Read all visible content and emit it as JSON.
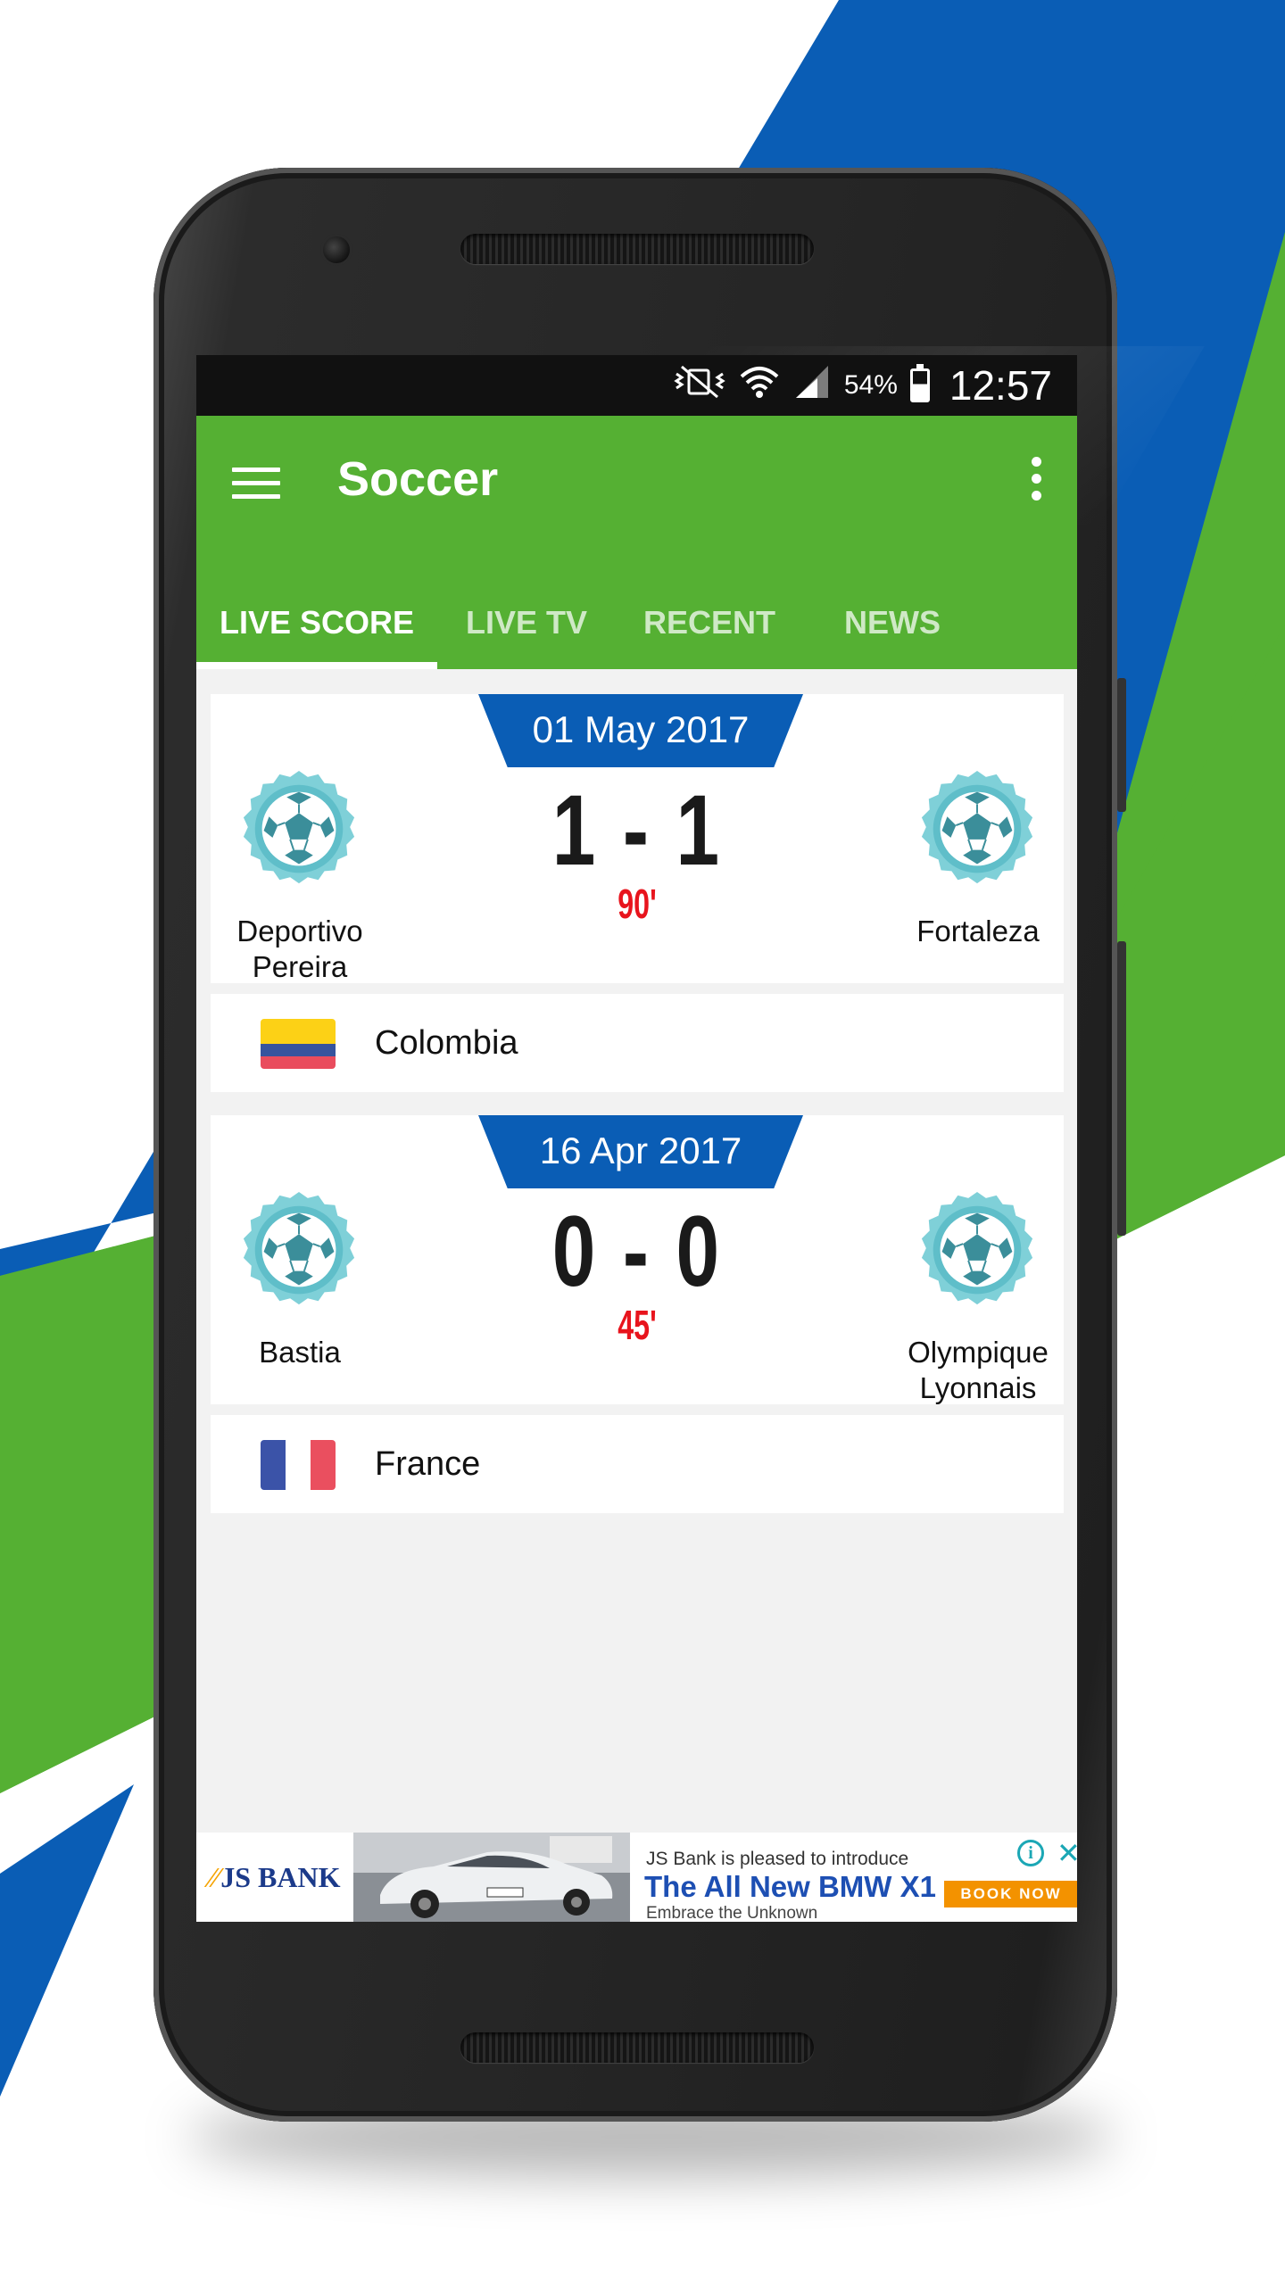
{
  "colors": {
    "background_blue": "#0a5db5",
    "background_green": "#55b033",
    "app_bar_green": "#55b033",
    "date_banner_blue": "#0a5db5",
    "minute_red": "#e8141d"
  },
  "status_bar": {
    "icons": [
      "vibrate-mute-icon",
      "wifi-icon",
      "signal-icon",
      "battery-icon"
    ],
    "battery": "54%",
    "time": "12:57"
  },
  "app_bar": {
    "menu_icon": "hamburger-menu-icon",
    "title": "Soccer",
    "overflow_icon": "more-vertical-icon"
  },
  "tabs": [
    {
      "label": "LIVE SCORE",
      "active": true
    },
    {
      "label": "LIVE TV",
      "active": false
    },
    {
      "label": "RECENT",
      "active": false
    },
    {
      "label": "NEWS",
      "active": false
    }
  ],
  "matches": [
    {
      "date": "01 May 2017",
      "home_team": "Deportivo Pereira",
      "away_team": "Fortaleza",
      "score": "1 - 1",
      "minute": "90'",
      "country": "Colombia",
      "flag": "colombia-flag-icon"
    },
    {
      "date": "16 Apr 2017",
      "home_team": "Bastia",
      "away_team": "Olympique Lyonnais",
      "score": "0 - 0",
      "minute": "45'",
      "country": "France",
      "flag": "france-flag-icon"
    }
  ],
  "ad": {
    "brand": "JS BANK",
    "intro": "JS Bank is pleased to introduce",
    "headline": "The All New BMW X1",
    "tagline": "Embrace the Unknown",
    "cta": "BOOK NOW",
    "info_icon": "info-icon",
    "close_icon": "close-icon"
  }
}
